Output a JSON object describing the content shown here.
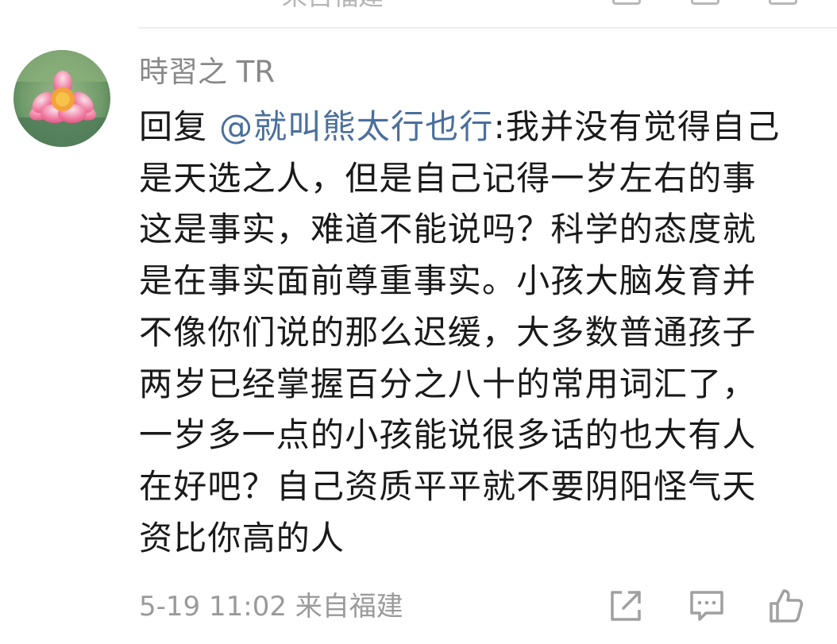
{
  "comment": {
    "username": "時習之 TR",
    "reply_prefix": "回复 ",
    "mention": "@就叫熊太行也行",
    "body": ":我并没有觉得自己是天选之人，但是自己记得一岁左右的事这是事实，难道不能说吗？科学的态度就是在事实面前尊重事实。小孩大脑发育并不像你们说的那么迟缓，大多数普通孩子两岁已经掌握百分之八十的常用词汇了，一岁多一点的小孩能说很多话的也大有人在好吧？自己资质平平就不要阴阳怪气天资比你高的人",
    "timestamp": "5-19 11:02",
    "source": "来自福建"
  },
  "previous_item": {
    "cut_text": "来自福建"
  },
  "icons": {
    "avatar": "lotus-flower-avatar",
    "share": "share-icon",
    "comment": "comment-icon",
    "like": "like-icon"
  },
  "colors": {
    "mention": "#4a6f9c",
    "text": "#1a1a1a",
    "meta": "#9a9a9a",
    "icon": "#a0a0a0"
  }
}
